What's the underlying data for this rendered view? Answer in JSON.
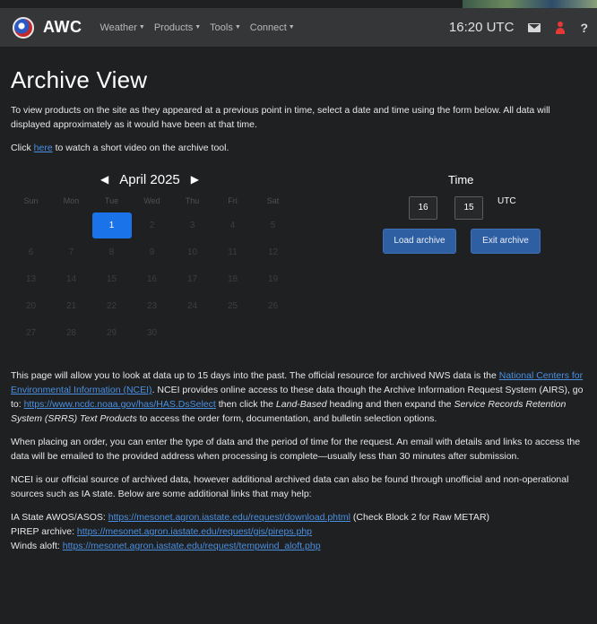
{
  "navbar": {
    "brand": "AWC",
    "menu": [
      {
        "label": "Weather"
      },
      {
        "label": "Products"
      },
      {
        "label": "Tools"
      },
      {
        "label": "Connect"
      }
    ],
    "clock": "16:20 UTC",
    "help": "?"
  },
  "page": {
    "title": "Archive View",
    "intro": "To view products on the site as they appeared at a previous point in time, select a date and time using the form below. All data will displayed approximately as it would have been at that time.",
    "video_pre": "Click ",
    "video_link": "here",
    "video_post": " to watch a short video on the archive tool."
  },
  "calendar": {
    "month": "April 2025",
    "prev": "◀",
    "next": "▶",
    "dows": [
      "Sun",
      "Mon",
      "Tue",
      "Wed",
      "Thu",
      "Fri",
      "Sat"
    ],
    "days": [
      "",
      "",
      "1",
      "2",
      "3",
      "4",
      "5",
      "6",
      "7",
      "8",
      "9",
      "10",
      "11",
      "12",
      "13",
      "14",
      "15",
      "16",
      "17",
      "18",
      "19",
      "20",
      "21",
      "22",
      "23",
      "24",
      "25",
      "26",
      "27",
      "28",
      "29",
      "30",
      "",
      "",
      ""
    ],
    "selected_day": "1"
  },
  "time": {
    "label": "Time",
    "hour": "16",
    "minute": "15",
    "tz": "UTC",
    "load_button": "Load archive",
    "exit_button": "Exit archive"
  },
  "body": {
    "p1_a": "This page will allow you to look at data up to 15 days into the past. The official resource for archived NWS data is the ",
    "p1_link": "National Centers for Environmental Information (NCEI)",
    "p1_b": ". NCEI provides online access to these data though the Archive Information Request System (AIRS), go to: ",
    "p1_url": "https://www.ncdc.noaa.gov/has/HAS.DsSelect",
    "p1_c": " then click the ",
    "p1_em1": "Land-Based",
    "p1_d": " heading and then expand the ",
    "p1_em2": "Service Records Retention System (SRRS) Text Products",
    "p1_e": " to access the order form, documentation, and bulletin selection options.",
    "p2": "When placing an order, you can enter the type of data and the period of time for the request. An email with details and links to access the data will be emailed to the provided address when processing is complete—usually less than 30 minutes after submission.",
    "p3": "NCEI is our official source of archived data, however additional archived data can also be found through unofficial and non-operational sources such as IA state. Below are some additional links that may help:"
  },
  "links": [
    {
      "label": "IA State AWOS/ASOS: ",
      "url": "https://mesonet.agron.iastate.edu/request/download.phtml",
      "note": " (Check Block 2 for Raw METAR)"
    },
    {
      "label": "PIREP archive: ",
      "url": "https://mesonet.agron.iastate.edu/request/gis/pireps.php",
      "note": ""
    },
    {
      "label": "Winds aloft: ",
      "url": "https://mesonet.agron.iastate.edu/request/tempwind_aloft.php",
      "note": ""
    }
  ],
  "colors": {
    "background": "#1f2022",
    "navbar": "#343638",
    "accent": "#1a73e8",
    "link": "#4a90e2",
    "button": "#2f5fa3"
  }
}
